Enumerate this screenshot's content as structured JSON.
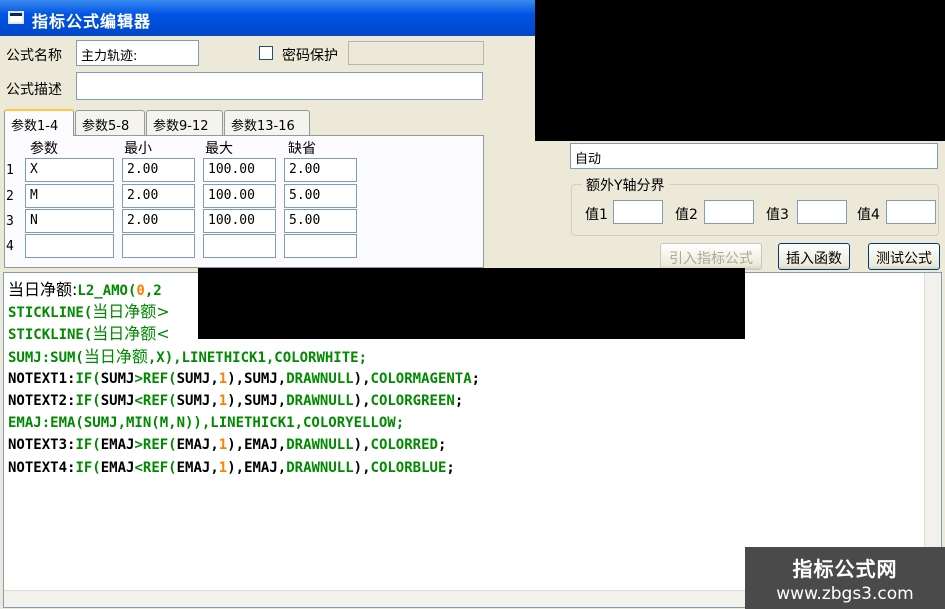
{
  "window": {
    "title": "指标公式编辑器"
  },
  "form": {
    "name_label": "公式名称",
    "name_value": "主力轨迹:",
    "password_label": "密码保护",
    "password_checked": false,
    "desc_label": "公式描述",
    "desc_value": ""
  },
  "tabs": [
    "参数1-4",
    "参数5-8",
    "参数9-12",
    "参数13-16"
  ],
  "params": {
    "headers": [
      "参数",
      "最小",
      "最大",
      "缺省"
    ],
    "rows": [
      {
        "num": "1",
        "name": "X",
        "min": "2.00",
        "max": "100.00",
        "default": "2.00"
      },
      {
        "num": "2",
        "name": "M",
        "min": "2.00",
        "max": "100.00",
        "default": "5.00"
      },
      {
        "num": "3",
        "name": "N",
        "min": "2.00",
        "max": "100.00",
        "default": "5.00"
      },
      {
        "num": "4",
        "name": "",
        "min": "",
        "max": "",
        "default": ""
      }
    ]
  },
  "axis": {
    "mode_value": "自动",
    "group_title": "额外Y轴分界",
    "value_labels": [
      "值1",
      "值2",
      "值3",
      "值4"
    ],
    "values": [
      "",
      "",
      "",
      ""
    ]
  },
  "buttons": {
    "import_formula": "引入指标公式",
    "insert_function": "插入函数",
    "test_formula": "测试公式"
  },
  "code": {
    "lines": [
      [
        [
          "当日净额:",
          "black"
        ],
        [
          "L2_AMO(",
          "green"
        ],
        [
          "0",
          "orange"
        ],
        [
          ",2",
          "green"
        ]
      ],
      [
        [
          "STICKLINE(",
          "green"
        ],
        [
          "当日净额>",
          "green"
        ]
      ],
      [
        [
          "STICKLINE(",
          "green"
        ],
        [
          "当日净额<",
          "green"
        ]
      ],
      [
        [
          "SUMJ:SUM(",
          "green"
        ],
        [
          "当日净额",
          "green"
        ],
        [
          ",X),LINETHICK1,COLORWHITE;",
          "green"
        ]
      ],
      [
        [
          "NOTEXT1:",
          "black"
        ],
        [
          "IF(",
          "green"
        ],
        [
          "SUMJ",
          "black"
        ],
        [
          ">",
          "green"
        ],
        [
          "REF(",
          "green"
        ],
        [
          "SUMJ,",
          "black"
        ],
        [
          "1",
          "orange"
        ],
        [
          "),",
          "black"
        ],
        [
          "SUMJ,",
          "black"
        ],
        [
          "DRAWNULL",
          "green"
        ],
        [
          "),",
          "black"
        ],
        [
          "COLORMAGENTA",
          "green"
        ],
        [
          ";",
          "black"
        ]
      ],
      [
        [
          "NOTEXT2:",
          "black"
        ],
        [
          "IF(",
          "green"
        ],
        [
          "SUMJ",
          "black"
        ],
        [
          "<",
          "green"
        ],
        [
          "REF(",
          "green"
        ],
        [
          "SUMJ,",
          "black"
        ],
        [
          "1",
          "orange"
        ],
        [
          "),",
          "black"
        ],
        [
          "SUMJ,",
          "black"
        ],
        [
          "DRAWNULL",
          "green"
        ],
        [
          "),",
          "black"
        ],
        [
          "COLORGREEN",
          "green"
        ],
        [
          ";",
          "black"
        ]
      ],
      [
        [
          "EMAJ:EMA(SUMJ,MIN(M,N)),LINETHICK1,COLORYELLOW;",
          "green"
        ]
      ],
      [
        [
          "NOTEXT3:",
          "black"
        ],
        [
          "IF(",
          "green"
        ],
        [
          "EMAJ",
          "black"
        ],
        [
          ">",
          "green"
        ],
        [
          "REF(",
          "green"
        ],
        [
          "EMAJ,",
          "black"
        ],
        [
          "1",
          "orange"
        ],
        [
          "),",
          "black"
        ],
        [
          "EMAJ,",
          "black"
        ],
        [
          "DRAWNULL",
          "green"
        ],
        [
          "),",
          "black"
        ],
        [
          "COLORRED",
          "green"
        ],
        [
          ";",
          "black"
        ]
      ],
      [
        [
          "NOTEXT4:",
          "black"
        ],
        [
          "IF(",
          "green"
        ],
        [
          "EMAJ",
          "black"
        ],
        [
          "<",
          "green"
        ],
        [
          "REF(",
          "green"
        ],
        [
          "EMAJ,",
          "black"
        ],
        [
          "1",
          "orange"
        ],
        [
          "),",
          "black"
        ],
        [
          "EMAJ,",
          "black"
        ],
        [
          "DRAWNULL",
          "green"
        ],
        [
          "),",
          "black"
        ],
        [
          "COLORBLUE",
          "green"
        ],
        [
          ";",
          "black"
        ]
      ]
    ]
  },
  "watermark": {
    "line1": "指标公式网",
    "line2": "www.zbgs3.com"
  },
  "colors": {
    "keyword_green": "#008a00",
    "number_orange": "#ff8000",
    "titlebar_blue": "#0054e3"
  }
}
